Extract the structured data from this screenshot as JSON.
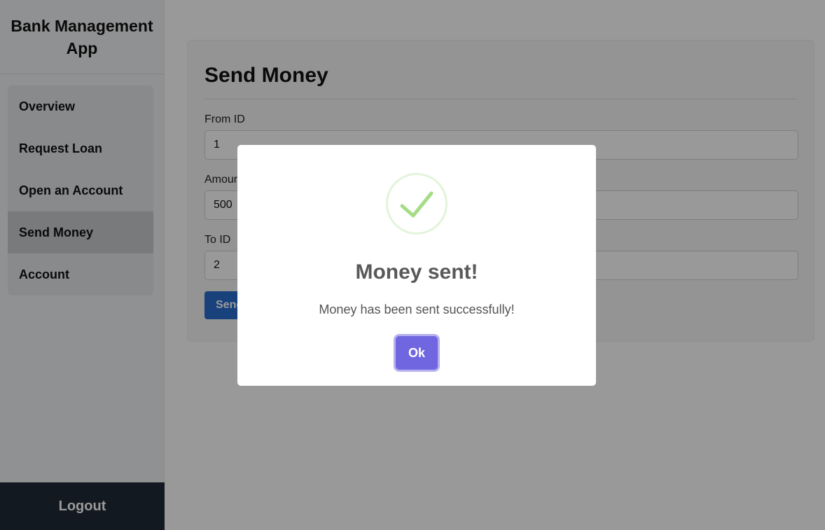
{
  "sidebar": {
    "brand": "Bank Management App",
    "items": [
      {
        "label": "Overview"
      },
      {
        "label": "Request Loan"
      },
      {
        "label": "Open an Account"
      },
      {
        "label": "Send Money"
      },
      {
        "label": "Account"
      }
    ],
    "active": "Send Money",
    "logout_label": "Logout"
  },
  "form": {
    "title": "Send Money",
    "from_label": "From ID",
    "from_value": "1",
    "amount_label": "Amount",
    "amount_value": "500",
    "to_label": "To ID",
    "to_value": "2",
    "submit_label": "Send"
  },
  "modal": {
    "icon": "checkmark-icon",
    "title": "Money sent!",
    "text": "Money has been sent successfully!",
    "ok_label": "Ok",
    "colors": {
      "confirm": "#7066e0",
      "success": "#a5dc86"
    }
  }
}
